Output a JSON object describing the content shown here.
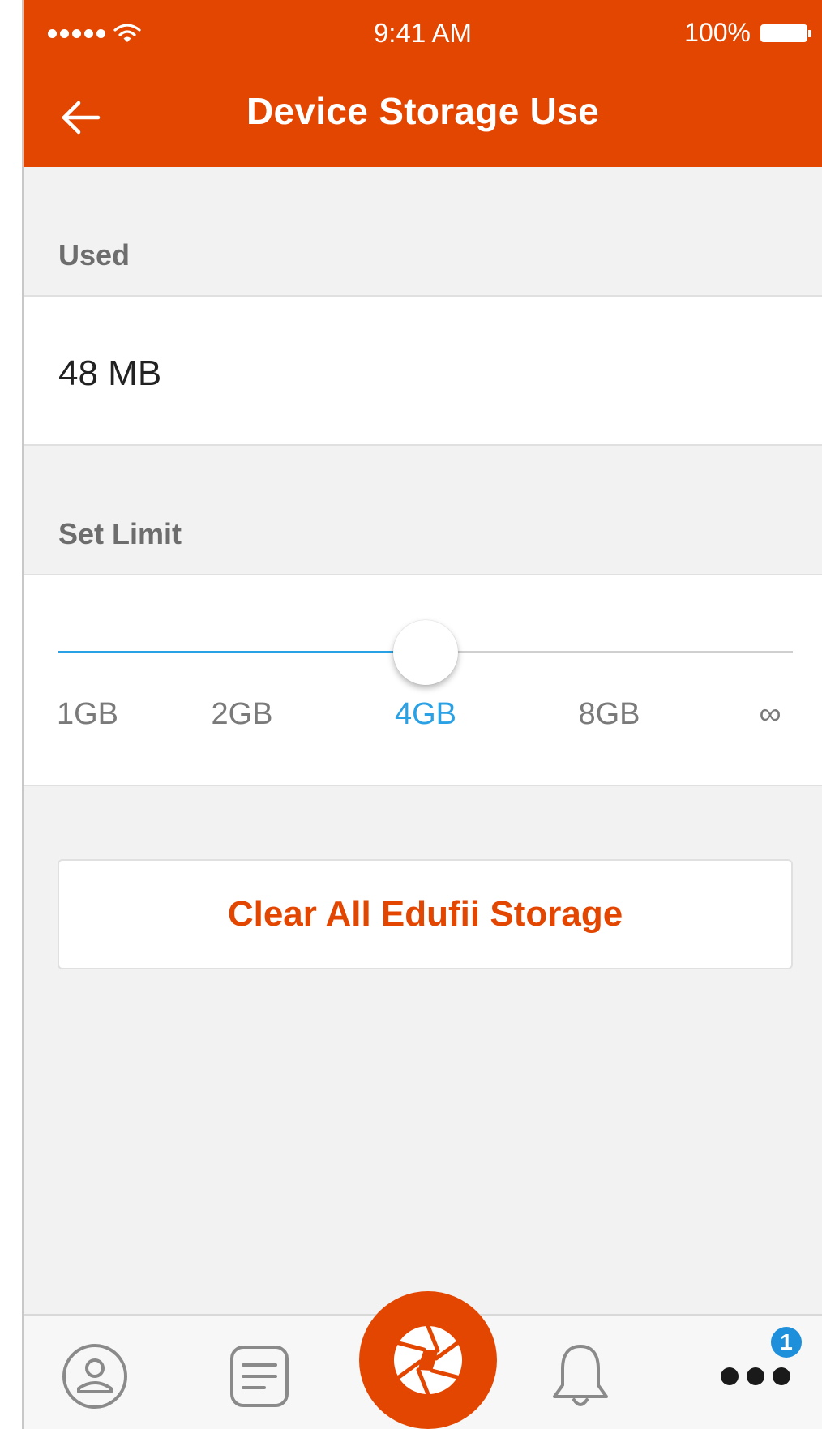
{
  "status_bar": {
    "time": "9:41 AM",
    "battery": "100%"
  },
  "nav": {
    "title": "Device Storage Use",
    "back_icon": "back-arrow-icon"
  },
  "used_section": {
    "label": "Used",
    "value": "48 MB"
  },
  "limit_section": {
    "label": "Set Limit",
    "ticks": [
      "1GB",
      "2GB",
      "4GB",
      "8GB",
      "∞"
    ],
    "selected_index": 2,
    "selected_value": "4GB"
  },
  "actions": {
    "clear_label": "Clear All Edufii Storage"
  },
  "tab_bar": {
    "tabs": [
      {
        "icon": "profile-icon"
      },
      {
        "icon": "feed-icon"
      },
      {
        "icon": "camera-shutter-icon"
      },
      {
        "icon": "notifications-bell-icon"
      },
      {
        "icon": "more-dots-icon"
      }
    ],
    "more_badge": "1"
  },
  "colors": {
    "brand": "#e34600",
    "accent": "#2aa1e4",
    "background": "#f2f2f2"
  }
}
